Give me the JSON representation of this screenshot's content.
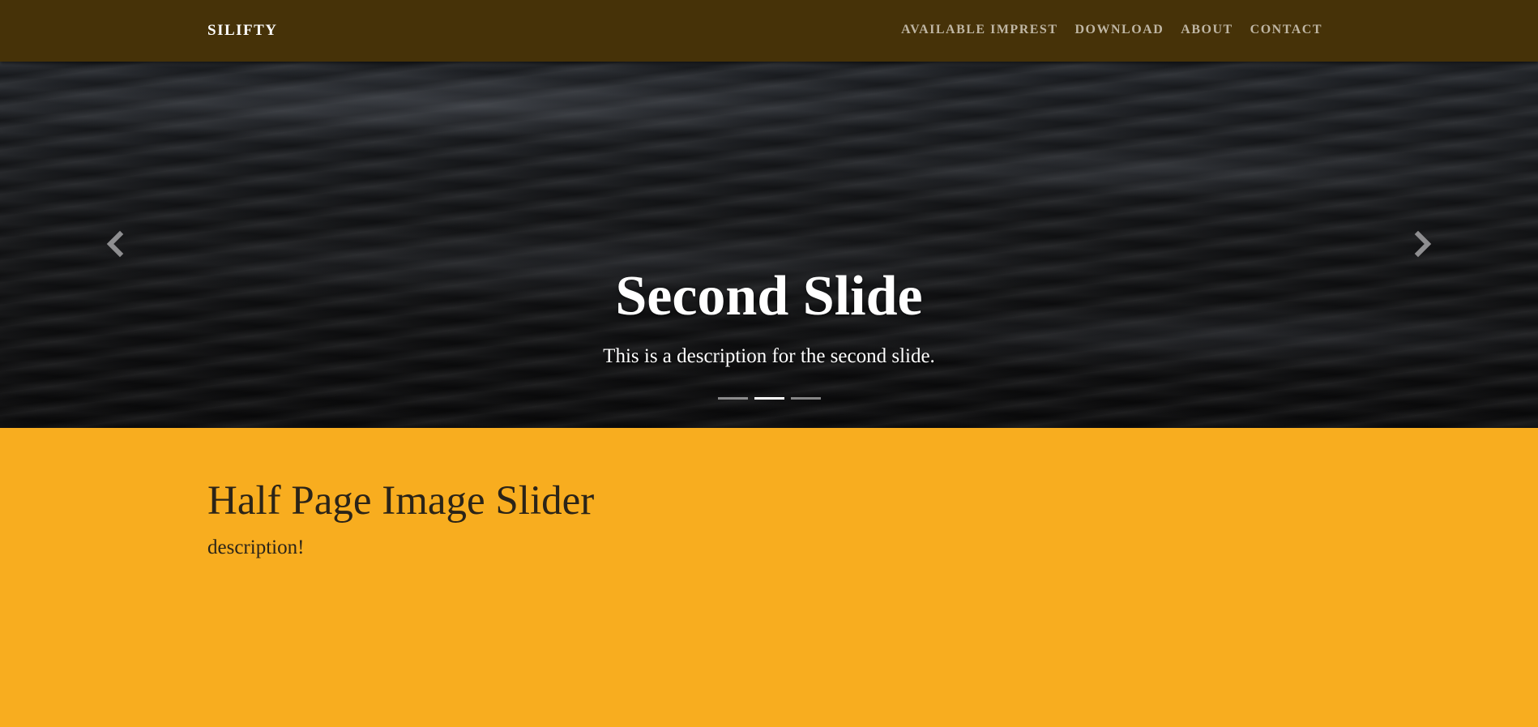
{
  "navbar": {
    "brand": "SILIFTY",
    "links": [
      {
        "label": "AVAILABLE IMPREST"
      },
      {
        "label": "DOWNLOAD"
      },
      {
        "label": "ABOUT"
      },
      {
        "label": "CONTACT"
      }
    ]
  },
  "carousel": {
    "active_slide": {
      "title": "Second Slide",
      "description": "This is a description for the second slide."
    },
    "indicator_count": 3,
    "active_index": 1,
    "prev_icon": "chevron-left-icon",
    "next_icon": "chevron-right-icon"
  },
  "content": {
    "heading": "Half Page Image Slider",
    "description": "description!"
  },
  "colors": {
    "navbar_bg": "#463208",
    "page_bg": "#f8ad1f",
    "nav_link": "#bfb6a4",
    "text_dark": "#2b2418"
  }
}
